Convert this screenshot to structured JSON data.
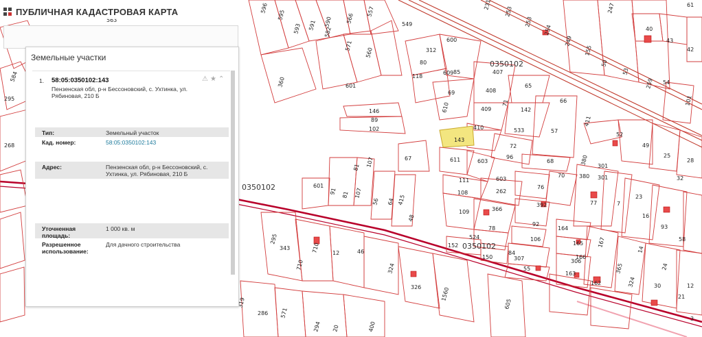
{
  "header": {
    "title": "ПУБЛИЧНАЯ КАДАСТРОВАЯ КАРТА"
  },
  "panel": {
    "title": "Земельные участки",
    "result": {
      "number": "1.",
      "cadastral_id": "58:05:0350102:143",
      "address_short": "Пензенская обл, р-н Бессоновский, с. Ухтинка, ул. Рябиновая, 210 Б",
      "fields": [
        {
          "key": "Тип:",
          "value": "Земельный участок"
        },
        {
          "key": "Кад. номер:",
          "value": "58:05:0350102:143"
        },
        {
          "key": "Адрес:",
          "value": "Пензенская обл, р-н Бессоновский, с. Ухтинка, ул. Рябиновая, 210 Б"
        },
        {
          "key": "Уточненная площадь:",
          "value": "1 000 кв. м"
        },
        {
          "key": "Разрешенное использование:",
          "value": "Для дачного строительства"
        }
      ]
    }
  },
  "map": {
    "selected_parcel": "143",
    "quarter_labels": [
      "0350102",
      "0350102",
      "0350102"
    ],
    "parcel_labels": [
      "563",
      "596",
      "595",
      "593",
      "591",
      "590",
      "582",
      "571",
      "560",
      "557",
      "549",
      "566",
      "584",
      "295",
      "268",
      "601",
      "360",
      "146",
      "89",
      "102",
      "67",
      "601",
      "91",
      "81",
      "107",
      "81",
      "107",
      "56",
      "64",
      "415",
      "48",
      "343",
      "710",
      "12",
      "46",
      "324",
      "326",
      "1560",
      "605",
      "319",
      "286",
      "571",
      "294",
      "20",
      "400",
      "600",
      "312",
      "80",
      "118",
      "609",
      "85",
      "69",
      "610",
      "407",
      "408",
      "409",
      "410",
      "611",
      "603",
      "65",
      "71",
      "142",
      "66",
      "533",
      "57",
      "72",
      "96",
      "68",
      "231",
      "253",
      "253",
      "254",
      "249",
      "155",
      "53",
      "259",
      "101",
      "247",
      "40",
      "43",
      "61",
      "42",
      "54",
      "52",
      "49",
      "25",
      "32",
      "411",
      "380",
      "301",
      "380",
      "301",
      "111",
      "603",
      "262",
      "76",
      "70",
      "108",
      "109",
      "366",
      "392",
      "77",
      "7",
      "23",
      "16",
      "93",
      "58",
      "78",
      "92",
      "106",
      "164",
      "165",
      "166",
      "306",
      "163",
      "162",
      "167",
      "365",
      "324",
      "30",
      "21",
      "152",
      "150",
      "84",
      "307",
      "55",
      "14",
      "24",
      "12",
      "3"
    ],
    "colors": {
      "parcel_line": "#d23b3b",
      "road": "#b8002a",
      "selected_fill": "#f3e680",
      "building": "#e84a4a"
    }
  }
}
